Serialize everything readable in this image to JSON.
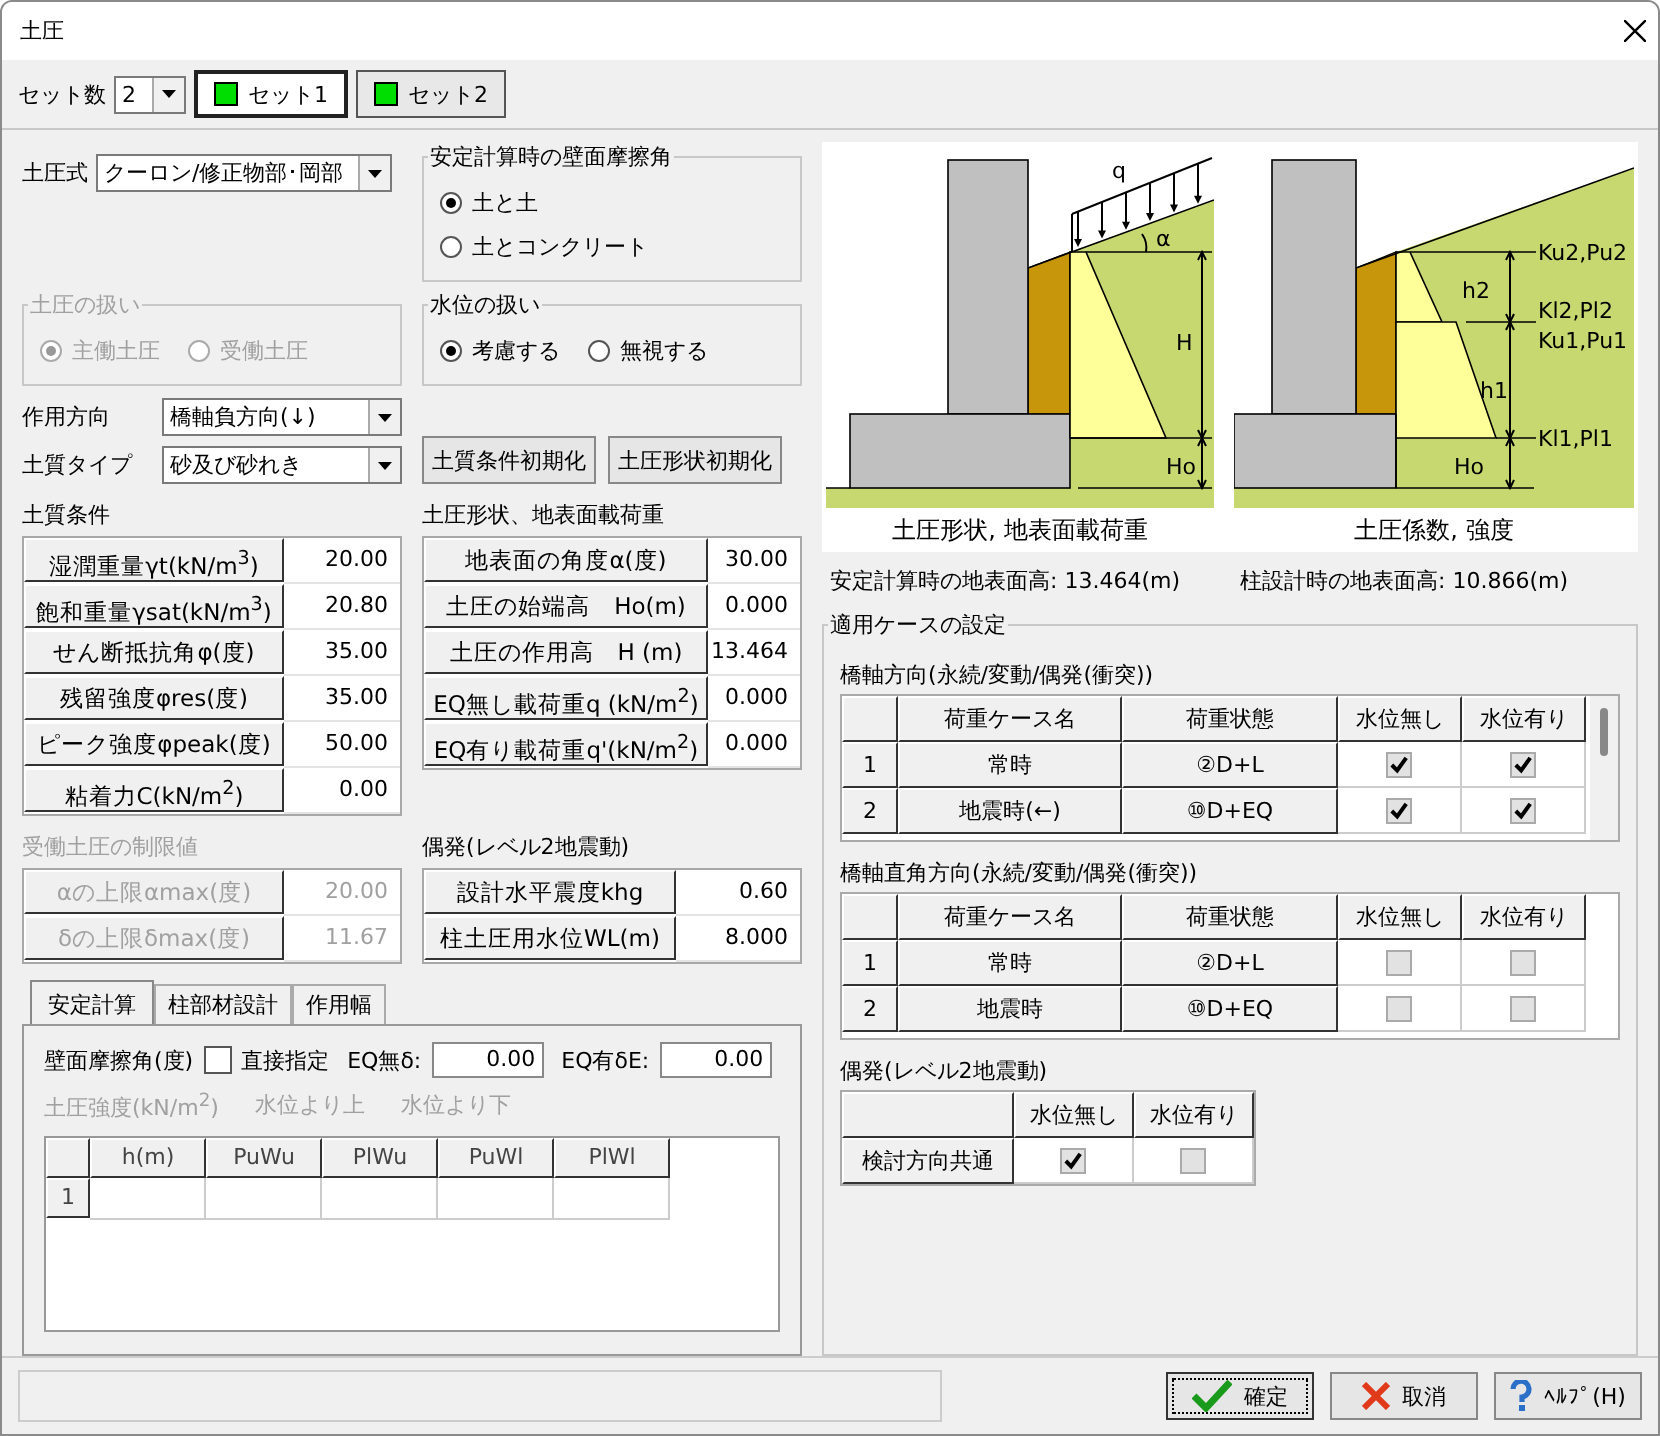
{
  "window": {
    "title": "土圧"
  },
  "set_count": {
    "label": "セット数",
    "value": "2"
  },
  "set_buttons": [
    {
      "label": "セット1",
      "selected": true
    },
    {
      "label": "セット2",
      "selected": false
    }
  ],
  "earth_pressure_formula": {
    "label": "土圧式",
    "value": "クーロン/修正物部･岡部"
  },
  "wall_friction_group": {
    "title": "安定計算時の壁面摩擦角",
    "disabled": false,
    "options": [
      {
        "label": "土と土",
        "selected": true
      },
      {
        "label": "土とコンクリート",
        "selected": false
      }
    ]
  },
  "pressure_handling_group": {
    "title": "土圧の扱い",
    "disabled": true,
    "options": [
      {
        "label": "主働土圧",
        "selected": true
      },
      {
        "label": "受働土圧",
        "selected": false
      }
    ]
  },
  "water_level_group": {
    "title": "水位の扱い",
    "disabled": false,
    "options": [
      {
        "label": "考慮する",
        "selected": true
      },
      {
        "label": "無視する",
        "selected": false
      }
    ]
  },
  "action_direction": {
    "label": "作用方向",
    "value": "橋軸負方向(↓)"
  },
  "soil_type": {
    "label": "土質タイプ",
    "value": "砂及び砂れき"
  },
  "init_buttons": [
    "土質条件初期化",
    "土圧形状初期化"
  ],
  "soil_conditions": {
    "title": "土質条件",
    "disabled": false,
    "rows": [
      {
        "label": "湿潤重量γt(kN/m$^{3}$)",
        "value": "20.00"
      },
      {
        "label": "飽和重量γsat(kN/m$^{3}$)",
        "value": "20.80"
      },
      {
        "label": "せん断抵抗角φ(度)",
        "value": "35.00"
      },
      {
        "label": "残留強度φres(度)",
        "value": "35.00"
      },
      {
        "label": "ピーク強度φpeak(度)",
        "value": "50.00"
      },
      {
        "label": "粘着力C(kN/m$^{2}$)",
        "value": "0.00"
      }
    ]
  },
  "shape_load": {
    "title": "土圧形状、地表面載荷重",
    "disabled": false,
    "rows": [
      {
        "label": "地表面の角度α(度)",
        "value": "30.00"
      },
      {
        "label": "土圧の始端高　Ho(m)",
        "value": "0.000"
      },
      {
        "label": "土圧の作用高　H (m)",
        "value": "13.464"
      },
      {
        "label": "EQ無し載荷重q (kN/m$^{2}$)",
        "value": "0.000"
      },
      {
        "label": "EQ有り載荷重q'(kN/m$^{2}$)",
        "value": "0.000"
      }
    ]
  },
  "passive_limits": {
    "title": "受働土圧の制限値",
    "disabled": true,
    "rows": [
      {
        "label": "αの上限αmax(度)",
        "value": "20.00"
      },
      {
        "label": "δの上限δmax(度)",
        "value": "11.67"
      }
    ]
  },
  "seismic": {
    "title": "偶発(レベル2地震動)",
    "disabled": false,
    "rows": [
      {
        "label": "設計水平震度khg",
        "value": "0.60"
      },
      {
        "label": "柱土圧用水位WL(m)",
        "value": "8.000"
      }
    ]
  },
  "tabs": [
    {
      "label": "安定計算",
      "selected": true
    },
    {
      "label": "柱部材設計",
      "selected": false
    },
    {
      "label": "作用幅",
      "selected": false
    }
  ],
  "tab_panel": {
    "friction_label": "壁面摩擦角(度)",
    "direct_checkbox": {
      "label": "直接指定",
      "checked": false
    },
    "eq_none": {
      "label": "EQ無δ:",
      "value": "0.00"
    },
    "eq_with": {
      "label": "EQ有δE:",
      "value": "0.00"
    },
    "strength": {
      "disabled": true,
      "labels": [
        "土圧強度(kN/m$^{2}$)",
        "水位より上",
        "水位より下"
      ]
    },
    "grid": {
      "columns": [
        "h(m)",
        "PuWu",
        "PlWu",
        "PuWl",
        "PlWl"
      ],
      "rows": [
        {
          "number": "1"
        }
      ]
    }
  },
  "diagrams": [
    {
      "kind": "shape",
      "caption": "土圧形状, 地表面載荷重",
      "labels": [
        "q",
        "α",
        "H",
        "Ho"
      ]
    },
    {
      "kind": "coefficient",
      "caption": "土圧係数, 強度",
      "labels": [
        "Ku2,Pu2",
        "h2",
        "Kl2,Pl2",
        "Ku1,Pu1",
        "h1",
        "Kl1,Pl1",
        "Ho"
      ]
    }
  ],
  "surface_heights": [
    "安定計算時の地表面高: 13.464(m)",
    "柱設計時の地表面高: 10.866(m)"
  ],
  "case_settings": {
    "title": "適用ケースの設定",
    "tables": [
      {
        "title": "橋軸方向(永続/変動/偶発(衝突))",
        "scrollable": true,
        "columns": [
          "荷重ケース名",
          "荷重状態",
          "水位無し",
          "水位有り"
        ],
        "rows": [
          {
            "number": "1",
            "name": "常時",
            "state": "②D+L",
            "no_water": true,
            "with_water": true
          },
          {
            "number": "2",
            "name": "地震時(←)",
            "state": "⑩D+EQ",
            "no_water": true,
            "with_water": true
          }
        ]
      },
      {
        "title": "橋軸直角方向(永続/変動/偶発(衝突))",
        "scrollable": false,
        "columns": [
          "荷重ケース名",
          "荷重状態",
          "水位無し",
          "水位有り"
        ],
        "rows": [
          {
            "number": "1",
            "name": "常時",
            "state": "②D+L",
            "no_water": false,
            "with_water": false
          },
          {
            "number": "2",
            "name": "地震時",
            "state": "⑩D+EQ",
            "no_water": false,
            "with_water": false
          }
        ]
      }
    ],
    "accidental": {
      "title": "偶発(レベル2地震動)",
      "columns": [
        "水位無し",
        "水位有り"
      ],
      "row_label": "検討方向共通",
      "no_water": true,
      "with_water": false
    }
  },
  "buttons": [
    {
      "kind": "ok",
      "label": "確定"
    },
    {
      "kind": "cancel",
      "label": "取消"
    },
    {
      "kind": "help",
      "label": "ﾍﾙﾌﾟ(H)"
    }
  ]
}
